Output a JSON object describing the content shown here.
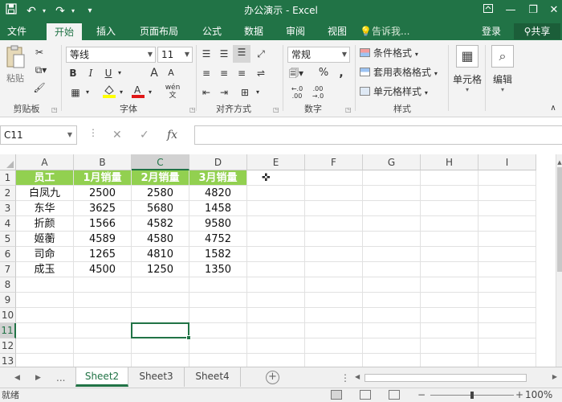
{
  "titlebar": {
    "title": "办公演示 - Excel",
    "save_icon": "save-icon",
    "undo_icon": "undo-icon",
    "redo_icon": "redo-icon"
  },
  "tabs": [
    {
      "label": "文件"
    },
    {
      "label": "开始"
    },
    {
      "label": "插入"
    },
    {
      "label": "页面布局"
    },
    {
      "label": "公式"
    },
    {
      "label": "数据"
    },
    {
      "label": "审阅"
    },
    {
      "label": "视图"
    }
  ],
  "active_tab": "开始",
  "tell_me": "告诉我...",
  "login": "登录",
  "share": "共享",
  "ribbon": {
    "clipboard": {
      "label": "剪贴板",
      "paste": "粘贴"
    },
    "font": {
      "label": "字体",
      "font_name": "等线",
      "font_size": "11",
      "bold": "B",
      "italic": "I",
      "underline": "U",
      "grow": "A",
      "shrink": "A",
      "phonetic": "wén"
    },
    "alignment": {
      "label": "对齐方式"
    },
    "number": {
      "label": "数字",
      "format": "常规",
      "percent": "%",
      "comma": ","
    },
    "styles": {
      "label": "样式",
      "conditional": "条件格式",
      "as_table": "套用表格格式",
      "cell_styles": "单元格样式"
    },
    "cells": {
      "label": "单元格"
    },
    "editing": {
      "label": "编辑"
    }
  },
  "formula_bar": {
    "name_box": "C11",
    "fx": "fx",
    "value": ""
  },
  "columns": [
    "A",
    "B",
    "C",
    "D",
    "E",
    "F",
    "G",
    "H",
    "I"
  ],
  "rows": [
    "1",
    "2",
    "3",
    "4",
    "5",
    "6",
    "7",
    "8",
    "9",
    "10",
    "11",
    "12",
    "13"
  ],
  "table": {
    "header": [
      "员工",
      "1月销量",
      "2月销量",
      "3月销量"
    ],
    "rows": [
      [
        "白凤九",
        "2500",
        "2580",
        "4820"
      ],
      [
        "东华",
        "3625",
        "5680",
        "1458"
      ],
      [
        "折颜",
        "1566",
        "4582",
        "9580"
      ],
      [
        "姬蘅",
        "4589",
        "4580",
        "4752"
      ],
      [
        "司命",
        "1265",
        "4810",
        "1582"
      ],
      [
        "成玉",
        "4500",
        "1250",
        "1350"
      ]
    ]
  },
  "selected_cell": "C11",
  "header_fill": "#92d050",
  "accent": "#217346",
  "sheets": [
    {
      "label": "Sheet2"
    },
    {
      "label": "Sheet3"
    },
    {
      "label": "Sheet4"
    }
  ],
  "active_sheet": "Sheet2",
  "sheet_overflow": "...",
  "status": {
    "ready": "就绪",
    "zoom": "100%"
  }
}
